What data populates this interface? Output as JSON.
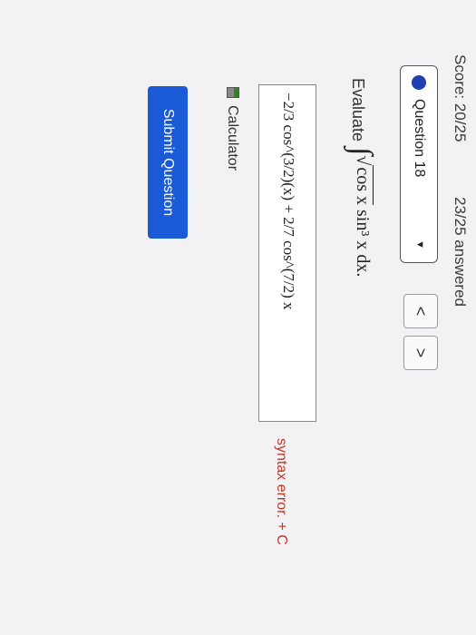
{
  "status": {
    "score": "Score: 20/25",
    "answered": "23/25 answered"
  },
  "question_nav": {
    "selected": "Question 18",
    "prev_label": "<",
    "next_label": ">"
  },
  "question": {
    "prompt": "Evaluate",
    "integral_sign": "∫",
    "integrand_root": "cos x",
    "integrand_rest": " sin³ x dx."
  },
  "answer": {
    "value": "−2/3 cos^(3/2)(x) + 2/7 cos^(7/2) x",
    "error": "syntax error. + C"
  },
  "calculator": {
    "label": "Calculator"
  },
  "submit": {
    "label": "Submit Question"
  },
  "colors": {
    "accent": "#1a5ad6",
    "dot": "#1f3fb3",
    "error": "#c0392b"
  }
}
